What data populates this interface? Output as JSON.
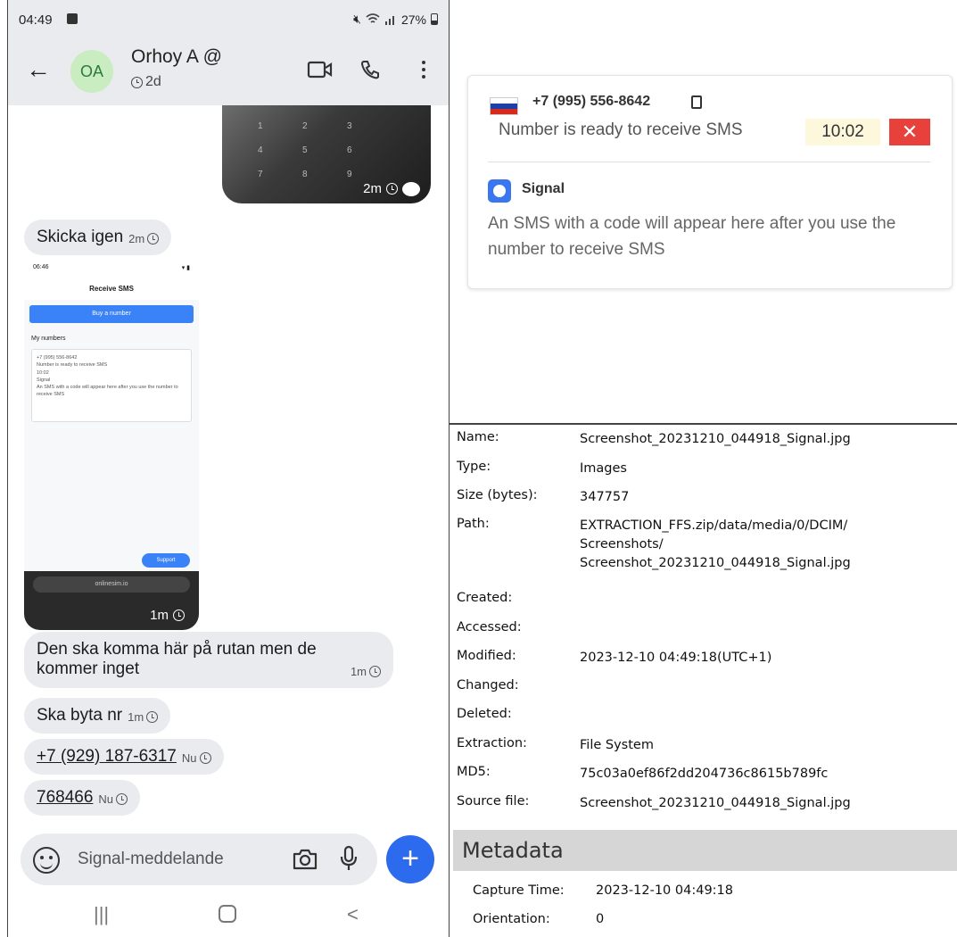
{
  "phone": {
    "status": {
      "time": "04:49",
      "battery": "27%"
    },
    "header": {
      "avatar_initials": "OA",
      "contact_name": "Orhoy A",
      "contact_badge": "@",
      "last_seen": "2d"
    },
    "image_top": {
      "keypad": [
        "1",
        "2",
        "3",
        "4",
        "5",
        "6",
        "7",
        "8",
        "9"
      ],
      "time": "2m"
    },
    "messages": [
      {
        "text": "Skicka igen",
        "time": "2m"
      }
    ],
    "screenshot_image": {
      "status_time": "06:46",
      "title": "Receive SMS",
      "buy_button": "Buy a number",
      "section": "My numbers",
      "card_number": "+7 (995) 556-8642",
      "card_ready": "Number is ready to receive SMS",
      "card_timer": "10:02",
      "card_app": "Signal",
      "card_note": "An SMS with a code will appear here after you use the number to receive SMS",
      "support": "Support",
      "url": "onlinesim.io",
      "time": "1m"
    },
    "messages2": [
      {
        "text": "Den ska komma här på rutan men de kommer inget",
        "time": "1m"
      },
      {
        "text": "Ska byta nr",
        "time": "1m"
      },
      {
        "text": "+7 (929) 187-6317",
        "time": "Nu"
      },
      {
        "text": "768466",
        "time": "Nu"
      }
    ],
    "composer": {
      "placeholder": "Signal-meddelande"
    }
  },
  "sms_card": {
    "flag_colors": [
      "#ffffff",
      "#1c3fa8",
      "#d52b1e"
    ],
    "phone_number": "+7 (995) 556-8642",
    "ready_text": "Number is ready to receive SMS",
    "timer": "10:02",
    "close_label": "✕",
    "app_name": "Signal",
    "note": "An SMS with a code will appear here after you use the number to receive SMS"
  },
  "file_info": {
    "rows": [
      {
        "key": "Name:",
        "value": "Screenshot_20231210_044918_Signal.jpg"
      },
      {
        "key": "Type:",
        "value": "Images"
      },
      {
        "key": "Size (bytes):",
        "value": "347757"
      },
      {
        "key": "Path:",
        "value": "EXTRACTION_FFS.zip/data/media/0/DCIM/\nScreenshots/\nScreenshot_20231210_044918_Signal.jpg"
      },
      {
        "key": "Created:",
        "value": ""
      },
      {
        "key": "Accessed:",
        "value": ""
      },
      {
        "key": "Modified:",
        "value": "2023-12-10 04:49:18(UTC+1)"
      },
      {
        "key": "Changed:",
        "value": ""
      },
      {
        "key": "Deleted:",
        "value": ""
      },
      {
        "key": "Extraction:",
        "value": "File System"
      },
      {
        "key": "MD5:",
        "value": "75c03a0ef86f2dd204736c8615b789fc"
      },
      {
        "key": "Source file:",
        "value": "Screenshot_20231210_044918_Signal.jpg"
      }
    ]
  },
  "metadata": {
    "header": "Metadata",
    "rows": [
      {
        "key": "Capture Time:",
        "value": "2023-12-10 04:49:18"
      },
      {
        "key": "Orientation:",
        "value": "0"
      }
    ]
  },
  "colors": {
    "signal_blue": "#2c6bed",
    "bubble_gray": "#e9ebee",
    "close_red": "#e8413c",
    "timer_bg": "#fdf8dc"
  }
}
